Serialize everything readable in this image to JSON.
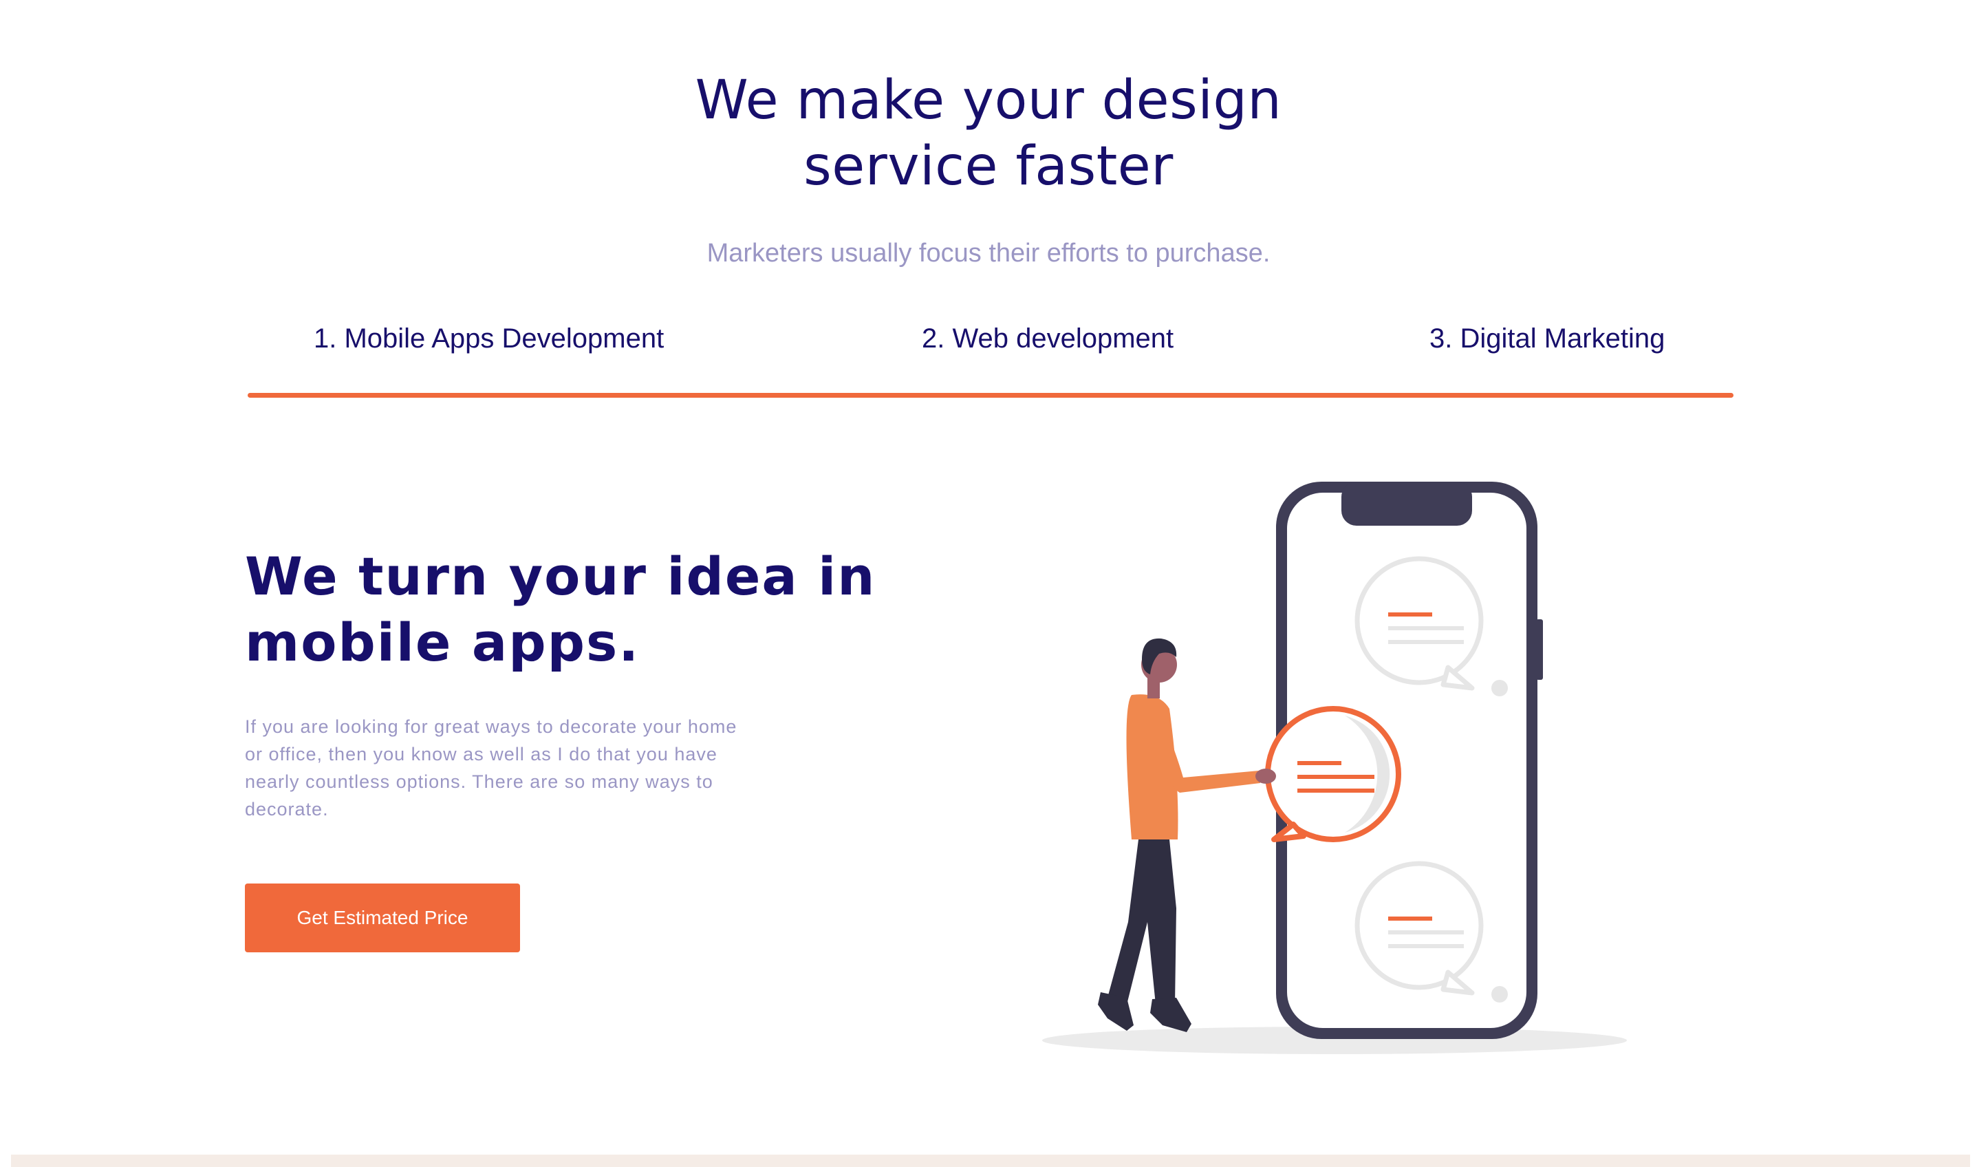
{
  "hero": {
    "title_line1": "We make your design",
    "title_line2": "service faster",
    "subtitle": "Marketers usually focus their efforts to purchase."
  },
  "tabs": [
    {
      "label": "1. Mobile Apps Development"
    },
    {
      "label": "2. Web development"
    },
    {
      "label": "3. Digital Marketing"
    }
  ],
  "section": {
    "title_line1": "We turn your idea in",
    "title_line2": "mobile apps.",
    "description": "If you are looking for great ways to decorate your home or office, then you know as well as I do that you have nearly countless options. There are so many ways to decorate.",
    "cta_label": "Get Estimated Price"
  },
  "colors": {
    "heading": "#170f6b",
    "muted": "#9a96c4",
    "accent": "#f0693b",
    "phone_frame": "#3f3d56",
    "footer_strip": "#f5ece6"
  },
  "illustration": {
    "name": "person-with-smartphone-chat-bubbles"
  }
}
